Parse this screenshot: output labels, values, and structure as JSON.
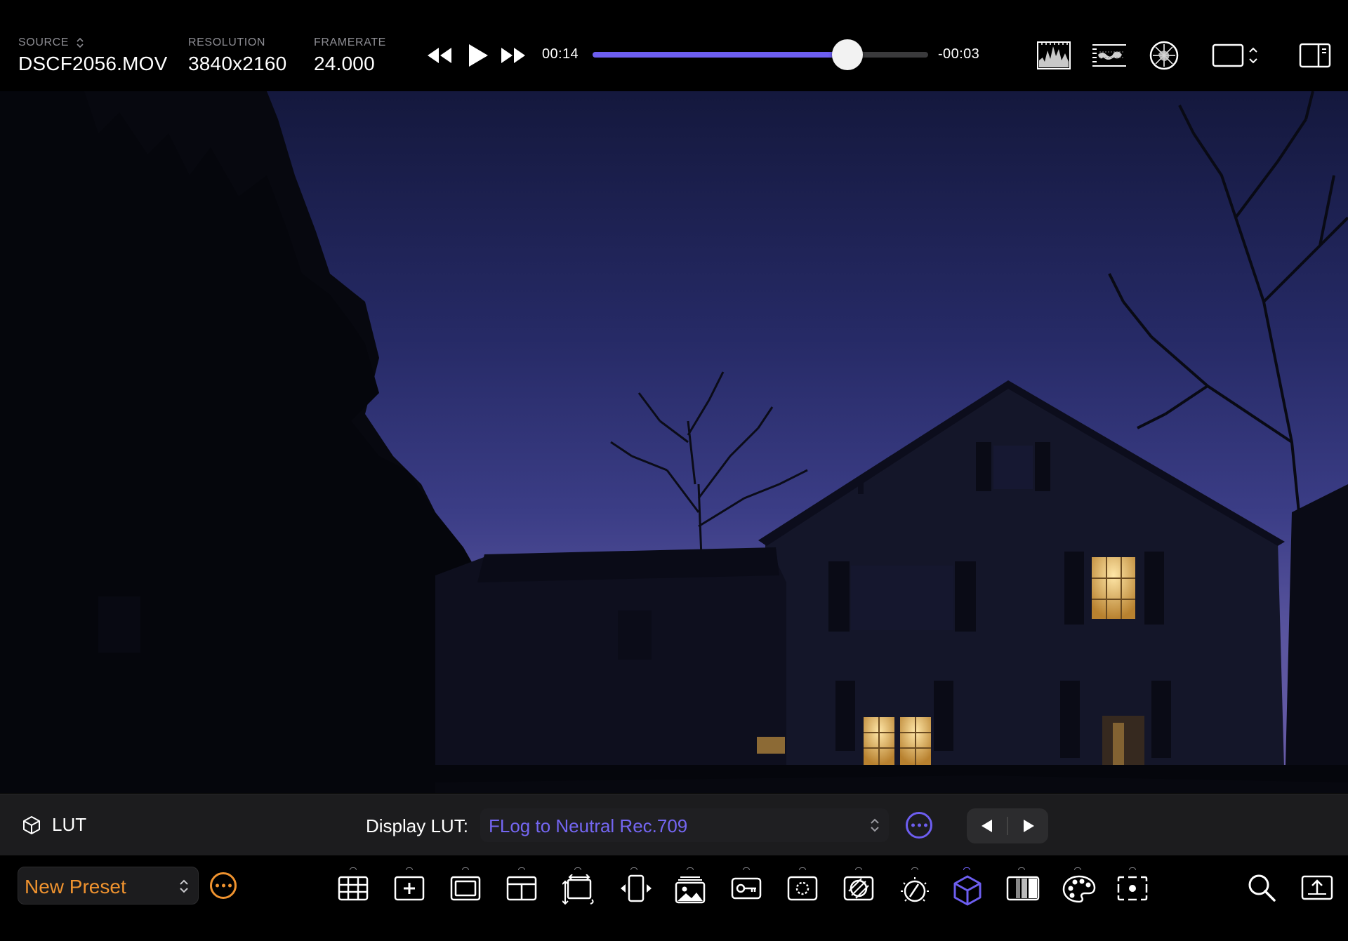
{
  "top_bar": {
    "source": {
      "label": "SOURCE",
      "value": "DSCF2056.MOV"
    },
    "resolution": {
      "label": "RESOLUTION",
      "value": "3840x2160"
    },
    "framerate": {
      "label": "FRAMERATE",
      "value": "24.000"
    },
    "transport": {
      "elapsed": "00:14",
      "remaining": "-00:03",
      "progress": 0.76
    },
    "right_icons": [
      "histogram-icon",
      "waveform-icon",
      "vectorscope-icon",
      "aspect-frame-icon",
      "sidebar-toggle-icon"
    ]
  },
  "lut_bar": {
    "title": "LUT",
    "display_lut_label": "Display LUT:",
    "display_lut_value": "FLog to Neutral Rec.709"
  },
  "bottom_bar": {
    "preset_name": "New Preset",
    "tools": [
      "grid-guides-icon",
      "crosshair-add-icon",
      "frame-guide-icon",
      "layout-guide-icon",
      "transform-icon",
      "flip-icon",
      "image-overlay-icon",
      "key-icon",
      "focus-peaking-icon",
      "false-color-icon",
      "exposure-meter-icon",
      "lut-cube-icon",
      "zebra-icon",
      "color-palette-icon",
      "spot-meter-icon"
    ],
    "active_tool": "lut-cube-icon"
  },
  "colors": {
    "accent": "#6d5ef0",
    "preset_orange": "#f0932f",
    "panel": "#1c1c1e"
  }
}
